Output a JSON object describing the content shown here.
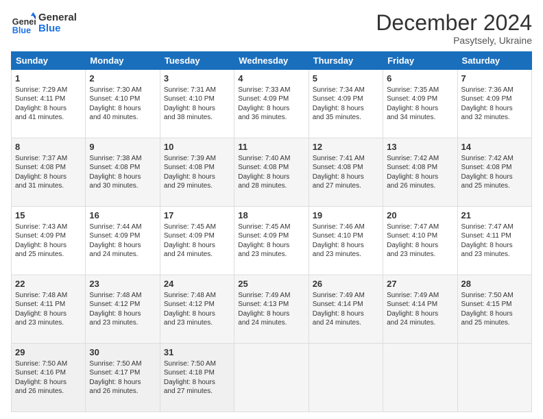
{
  "header": {
    "logo_line1": "General",
    "logo_line2": "Blue",
    "main_title": "December 2024",
    "subtitle": "Pasytsely, Ukraine"
  },
  "days_of_week": [
    "Sunday",
    "Monday",
    "Tuesday",
    "Wednesday",
    "Thursday",
    "Friday",
    "Saturday"
  ],
  "weeks": [
    [
      {
        "day": "1",
        "lines": [
          "Sunrise: 7:29 AM",
          "Sunset: 4:11 PM",
          "Daylight: 8 hours",
          "and 41 minutes."
        ]
      },
      {
        "day": "2",
        "lines": [
          "Sunrise: 7:30 AM",
          "Sunset: 4:10 PM",
          "Daylight: 8 hours",
          "and 40 minutes."
        ]
      },
      {
        "day": "3",
        "lines": [
          "Sunrise: 7:31 AM",
          "Sunset: 4:10 PM",
          "Daylight: 8 hours",
          "and 38 minutes."
        ]
      },
      {
        "day": "4",
        "lines": [
          "Sunrise: 7:33 AM",
          "Sunset: 4:09 PM",
          "Daylight: 8 hours",
          "and 36 minutes."
        ]
      },
      {
        "day": "5",
        "lines": [
          "Sunrise: 7:34 AM",
          "Sunset: 4:09 PM",
          "Daylight: 8 hours",
          "and 35 minutes."
        ]
      },
      {
        "day": "6",
        "lines": [
          "Sunrise: 7:35 AM",
          "Sunset: 4:09 PM",
          "Daylight: 8 hours",
          "and 34 minutes."
        ]
      },
      {
        "day": "7",
        "lines": [
          "Sunrise: 7:36 AM",
          "Sunset: 4:09 PM",
          "Daylight: 8 hours",
          "and 32 minutes."
        ]
      }
    ],
    [
      {
        "day": "8",
        "lines": [
          "Sunrise: 7:37 AM",
          "Sunset: 4:08 PM",
          "Daylight: 8 hours",
          "and 31 minutes."
        ]
      },
      {
        "day": "9",
        "lines": [
          "Sunrise: 7:38 AM",
          "Sunset: 4:08 PM",
          "Daylight: 8 hours",
          "and 30 minutes."
        ]
      },
      {
        "day": "10",
        "lines": [
          "Sunrise: 7:39 AM",
          "Sunset: 4:08 PM",
          "Daylight: 8 hours",
          "and 29 minutes."
        ]
      },
      {
        "day": "11",
        "lines": [
          "Sunrise: 7:40 AM",
          "Sunset: 4:08 PM",
          "Daylight: 8 hours",
          "and 28 minutes."
        ]
      },
      {
        "day": "12",
        "lines": [
          "Sunrise: 7:41 AM",
          "Sunset: 4:08 PM",
          "Daylight: 8 hours",
          "and 27 minutes."
        ]
      },
      {
        "day": "13",
        "lines": [
          "Sunrise: 7:42 AM",
          "Sunset: 4:08 PM",
          "Daylight: 8 hours",
          "and 26 minutes."
        ]
      },
      {
        "day": "14",
        "lines": [
          "Sunrise: 7:42 AM",
          "Sunset: 4:08 PM",
          "Daylight: 8 hours",
          "and 25 minutes."
        ]
      }
    ],
    [
      {
        "day": "15",
        "lines": [
          "Sunrise: 7:43 AM",
          "Sunset: 4:09 PM",
          "Daylight: 8 hours",
          "and 25 minutes."
        ]
      },
      {
        "day": "16",
        "lines": [
          "Sunrise: 7:44 AM",
          "Sunset: 4:09 PM",
          "Daylight: 8 hours",
          "and 24 minutes."
        ]
      },
      {
        "day": "17",
        "lines": [
          "Sunrise: 7:45 AM",
          "Sunset: 4:09 PM",
          "Daylight: 8 hours",
          "and 24 minutes."
        ]
      },
      {
        "day": "18",
        "lines": [
          "Sunrise: 7:45 AM",
          "Sunset: 4:09 PM",
          "Daylight: 8 hours",
          "and 23 minutes."
        ]
      },
      {
        "day": "19",
        "lines": [
          "Sunrise: 7:46 AM",
          "Sunset: 4:10 PM",
          "Daylight: 8 hours",
          "and 23 minutes."
        ]
      },
      {
        "day": "20",
        "lines": [
          "Sunrise: 7:47 AM",
          "Sunset: 4:10 PM",
          "Daylight: 8 hours",
          "and 23 minutes."
        ]
      },
      {
        "day": "21",
        "lines": [
          "Sunrise: 7:47 AM",
          "Sunset: 4:11 PM",
          "Daylight: 8 hours",
          "and 23 minutes."
        ]
      }
    ],
    [
      {
        "day": "22",
        "lines": [
          "Sunrise: 7:48 AM",
          "Sunset: 4:11 PM",
          "Daylight: 8 hours",
          "and 23 minutes."
        ]
      },
      {
        "day": "23",
        "lines": [
          "Sunrise: 7:48 AM",
          "Sunset: 4:12 PM",
          "Daylight: 8 hours",
          "and 23 minutes."
        ]
      },
      {
        "day": "24",
        "lines": [
          "Sunrise: 7:48 AM",
          "Sunset: 4:12 PM",
          "Daylight: 8 hours",
          "and 23 minutes."
        ]
      },
      {
        "day": "25",
        "lines": [
          "Sunrise: 7:49 AM",
          "Sunset: 4:13 PM",
          "Daylight: 8 hours",
          "and 24 minutes."
        ]
      },
      {
        "day": "26",
        "lines": [
          "Sunrise: 7:49 AM",
          "Sunset: 4:14 PM",
          "Daylight: 8 hours",
          "and 24 minutes."
        ]
      },
      {
        "day": "27",
        "lines": [
          "Sunrise: 7:49 AM",
          "Sunset: 4:14 PM",
          "Daylight: 8 hours",
          "and 24 minutes."
        ]
      },
      {
        "day": "28",
        "lines": [
          "Sunrise: 7:50 AM",
          "Sunset: 4:15 PM",
          "Daylight: 8 hours",
          "and 25 minutes."
        ]
      }
    ],
    [
      {
        "day": "29",
        "lines": [
          "Sunrise: 7:50 AM",
          "Sunset: 4:16 PM",
          "Daylight: 8 hours",
          "and 26 minutes."
        ]
      },
      {
        "day": "30",
        "lines": [
          "Sunrise: 7:50 AM",
          "Sunset: 4:17 PM",
          "Daylight: 8 hours",
          "and 26 minutes."
        ]
      },
      {
        "day": "31",
        "lines": [
          "Sunrise: 7:50 AM",
          "Sunset: 4:18 PM",
          "Daylight: 8 hours",
          "and 27 minutes."
        ]
      },
      null,
      null,
      null,
      null
    ]
  ]
}
